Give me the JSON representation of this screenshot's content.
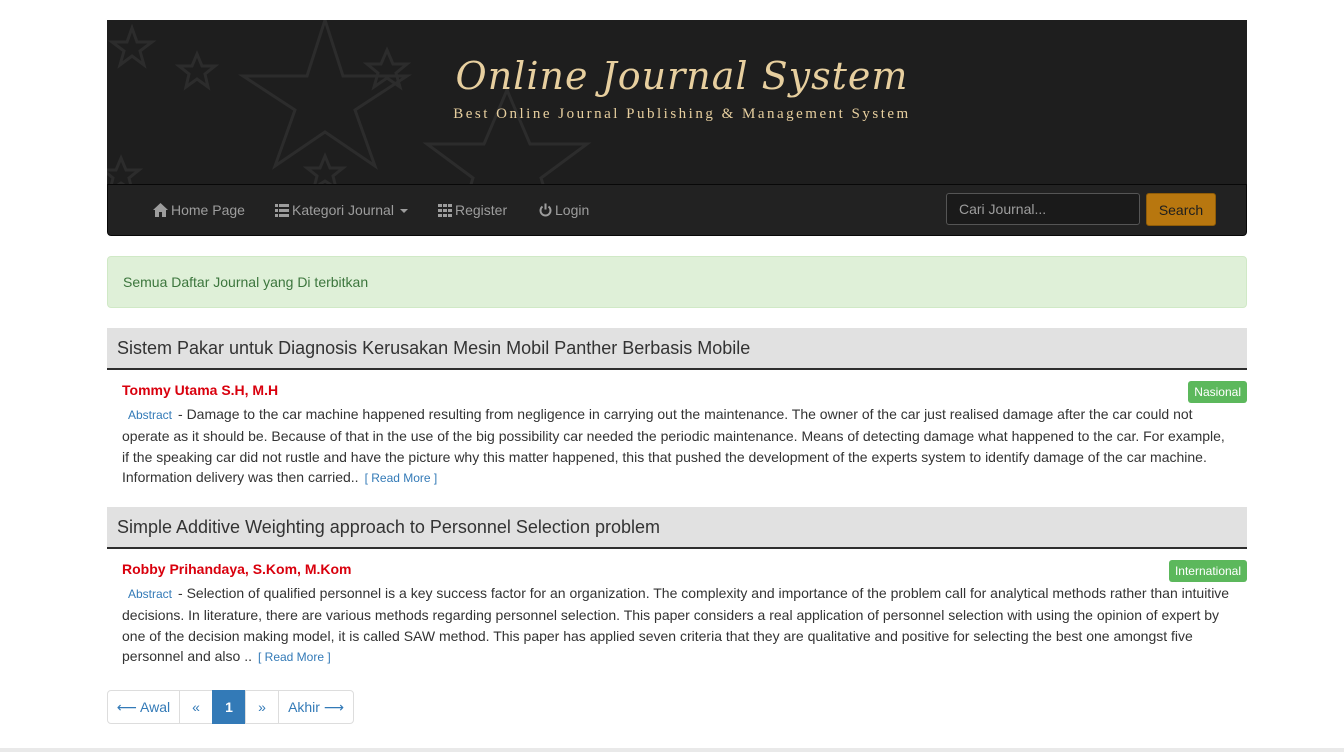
{
  "header": {
    "title": "Online Journal System",
    "subtitle": "Best Online Journal Publishing & Management System"
  },
  "navbar": {
    "items": [
      {
        "label": "Home Page",
        "icon": "home-icon"
      },
      {
        "label": "Kategori Journal",
        "icon": "list-icon"
      },
      {
        "label": "Register",
        "icon": "grid-icon"
      },
      {
        "label": "Login",
        "icon": "power-icon"
      }
    ],
    "search": {
      "placeholder": "Cari Journal...",
      "button_label": "Search"
    }
  },
  "alert": {
    "text": "Semua Daftar Journal yang Di terbitkan"
  },
  "articles": [
    {
      "title": "Sistem Pakar untuk Diagnosis Kerusakan Mesin Mobil Panther Berbasis Mobile",
      "author": "Tommy Utama S.H, M.H",
      "badge": "Nasional",
      "abstract_label": "Abstract",
      "abstract": "- Damage to the car machine happened resulting from negligence in carrying out the maintenance. The owner of the car just realised damage after the car could not operate as it should be. Because of that in the use of the big possibility car needed the periodic maintenance. Means of detecting damage what happened to the car. For example, if the speaking car did not rustle and have the picture why this matter happened, this that pushed the development of the experts system to identify damage of the car machine. Information delivery was then carried..",
      "read_more": "[ Read More ]"
    },
    {
      "title": "Simple Additive Weighting approach to Personnel Selection problem",
      "author": "Robby Prihandaya, S.Kom, M.Kom",
      "badge": "International",
      "abstract_label": "Abstract",
      "abstract": "- Selection of qualified personnel is a key success factor for an organization. The complexity and importance of the problem call for analytical methods rather than intuitive decisions. In literature, there are various methods regarding personnel selection. This paper considers a real application of personnel selection with using the opinion of expert by one of the decision making model, it is called SAW method. This paper has applied seven criteria that they are qualitative and positive for selecting the best one amongst five personnel and also ..",
      "read_more": "[ Read More ]"
    }
  ],
  "pagination": {
    "first": "⟵ Awal",
    "prev": "«",
    "current": "1",
    "next": "»",
    "last": "Akhir ⟶"
  },
  "colors": {
    "banner_bg": "#1e1e1e",
    "banner_text": "#e7cf9f",
    "navbar_bg": "#222222",
    "search_button": "#b8770f",
    "author": "#d9000d",
    "badge": "#5cb85c",
    "link": "#337ab7",
    "alert_bg": "#dff0d8"
  }
}
